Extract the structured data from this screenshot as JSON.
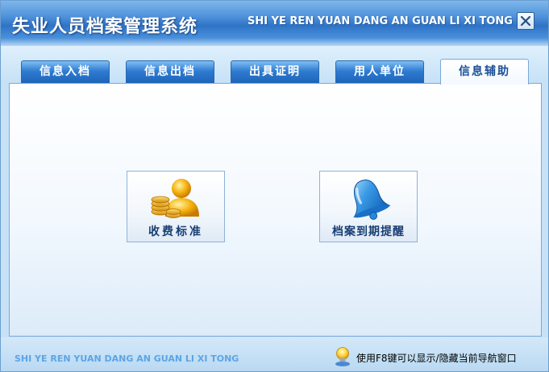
{
  "window": {
    "title": "失业人员档案管理系统",
    "subtitle": "SHI YE REN YUAN DANG AN GUAN LI XI TONG",
    "close_icon": "close-icon"
  },
  "tabs": [
    {
      "label": "信息入档",
      "active": false
    },
    {
      "label": "信息出档",
      "active": false
    },
    {
      "label": "出具证明",
      "active": false
    },
    {
      "label": "用人单位",
      "active": false
    },
    {
      "label": "信息辅助",
      "active": true
    }
  ],
  "tiles": [
    {
      "label": "收费标准",
      "icon": "user-coins-icon"
    },
    {
      "label": "档案到期提醒",
      "icon": "bell-icon"
    }
  ],
  "footer": {
    "text": "SHI YE REN YUAN DANG AN GUAN LI XI TONG",
    "hint": "使用F8键可以显示/隐藏当前导航窗口",
    "hint_icon": "lightbulb-icon"
  },
  "colors": {
    "title_blue": "#2f73c7",
    "tab_blue": "#2f7cd2",
    "footer_text": "#5da4e6",
    "tile_label": "#183e73"
  }
}
